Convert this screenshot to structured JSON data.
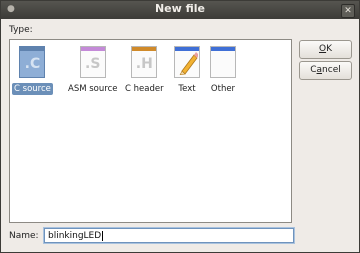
{
  "window": {
    "title": "New file"
  },
  "type_section": {
    "label": "Type:",
    "items": [
      {
        "label": "C source",
        "glyph": "C",
        "band_color": "#5f82ae",
        "selected": true
      },
      {
        "label": "ASM source",
        "glyph": "S",
        "band_color": "#b06fc9",
        "selected": false
      },
      {
        "label": "C header",
        "glyph": "H",
        "band_color": "#d08a2a",
        "selected": false
      },
      {
        "label": "Text",
        "glyph": "",
        "band_color": "#3f6fd6",
        "selected": false
      },
      {
        "label": "Other",
        "glyph": "",
        "band_color": "#3f6fd6",
        "selected": false
      }
    ]
  },
  "buttons": {
    "ok": {
      "mnemonic": "O",
      "rest": "K"
    },
    "cancel": {
      "prefix": "C",
      "mnemonic": "a",
      "rest": "ncel"
    }
  },
  "name_field": {
    "label": "Name:",
    "value": "blinkingLED"
  }
}
